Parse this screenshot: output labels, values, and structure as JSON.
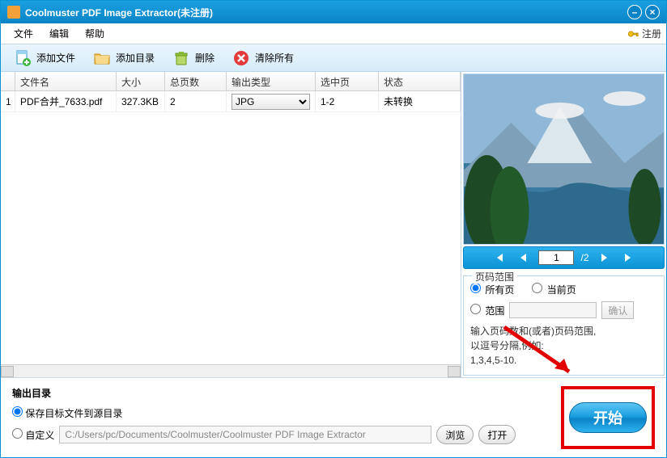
{
  "title": "Coolmuster PDF Image Extractor(未注册)",
  "menubar": {
    "file": "文件",
    "edit": "编辑",
    "help": "帮助",
    "register": "注册"
  },
  "toolbar": {
    "add_file": "添加文件",
    "add_folder": "添加目录",
    "delete": "删除",
    "clear_all": "清除所有"
  },
  "table": {
    "headers": {
      "name": "文件名",
      "size": "大小",
      "pages": "总页数",
      "type": "输出类型",
      "selected": "选中页",
      "status": "状态"
    },
    "rows": [
      {
        "idx": "1",
        "name": "PDF合并_7633.pdf",
        "size": "327.3KB",
        "pages": "2",
        "type": "JPG",
        "selected": "1-2",
        "status": "未转换"
      }
    ]
  },
  "pager": {
    "current": "1",
    "total": "/2"
  },
  "range": {
    "legend": "页码范围",
    "all_pages": "所有页",
    "current_page": "当前页",
    "range_label": "范围",
    "confirm": "确认",
    "hint1": "输入页码数和(或者)页码范围,",
    "hint2": "以逗号分隔,例如:",
    "hint3": "1,3,4,5-10."
  },
  "output": {
    "title": "输出目录",
    "save_to_source": "保存目标文件到源目录",
    "custom": "自定义",
    "path": "C:/Users/pc/Documents/Coolmuster/Coolmuster PDF Image Extractor",
    "browse": "浏览",
    "open": "打开"
  },
  "start": "开始"
}
